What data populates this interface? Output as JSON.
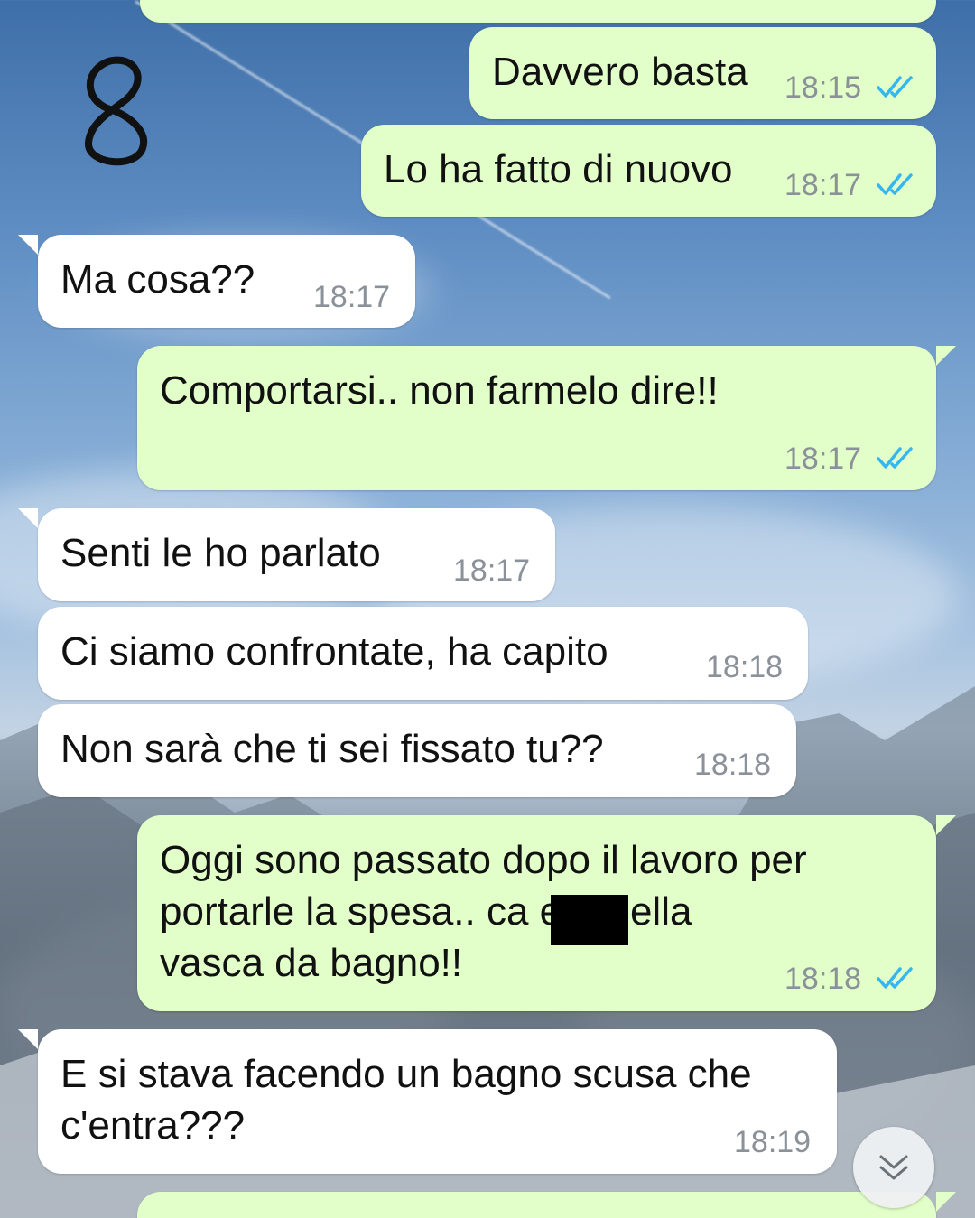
{
  "annotation": "8",
  "messages": [
    {
      "id": "m0",
      "dir": "out",
      "text": "",
      "time": ""
    },
    {
      "id": "m1",
      "dir": "out",
      "text": "Davvero basta",
      "time": "18:15"
    },
    {
      "id": "m2",
      "dir": "out",
      "text": "Lo ha fatto di nuovo",
      "time": "18:17"
    },
    {
      "id": "m3",
      "dir": "in",
      "text": "Ma cosa??",
      "time": "18:17"
    },
    {
      "id": "m4",
      "dir": "out",
      "text": "Comportarsi.. non farmelo dire!!",
      "time": "18:17"
    },
    {
      "id": "m5",
      "dir": "in",
      "text": "Senti le ho parlato",
      "time": "18:17"
    },
    {
      "id": "m6",
      "dir": "in",
      "text": "Ci siamo confrontate, ha capito",
      "time": "18:18"
    },
    {
      "id": "m7",
      "dir": "in",
      "text": "Non sarà che ti sei fissato tu??",
      "time": "18:18"
    },
    {
      "id": "m8",
      "dir": "out",
      "text": "Oggi sono passato dopo il lavoro per\nportarle la spesa.. ca           era nella\nvasca da bagno!!",
      "time": "18:18"
    },
    {
      "id": "m9",
      "dir": "in",
      "text": "E si stava facendo un bagno scusa che\nc'entra???",
      "time": "18:19"
    }
  ],
  "icons": {
    "read_receipt": "double-check-icon",
    "scroll_down": "chevron-double-down-icon"
  },
  "colors": {
    "outgoing_bubble": "#e2ffc9",
    "incoming_bubble": "#ffffff",
    "read_tick": "#34b7f1",
    "timestamp": "#8a9199"
  }
}
